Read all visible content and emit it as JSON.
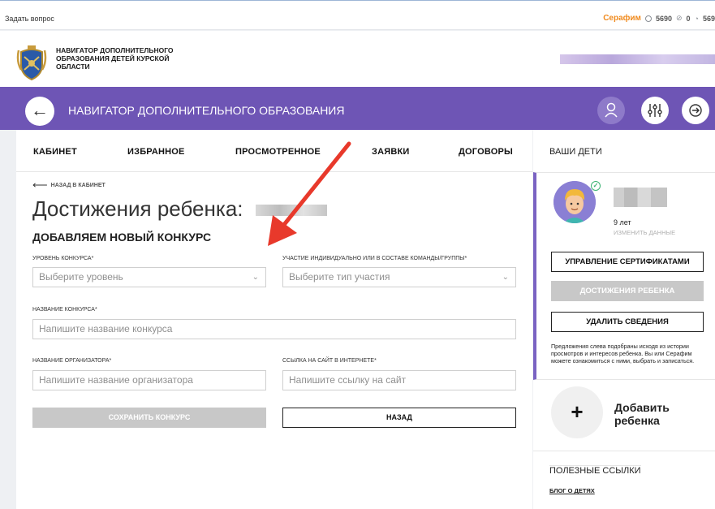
{
  "topbar": {
    "ask_label": "Задать вопрос",
    "user_name": "Серафим",
    "stats": [
      "5690",
      "0",
      "569"
    ]
  },
  "header": {
    "logo_text": "НАВИГАТОР ДОПОЛНИТЕЛЬНОГО ОБРАЗОВАНИЯ ДЕТЕЙ КУРСКОЙ ОБЛАСТИ"
  },
  "navbar": {
    "title": "НАВИГАТОР ДОПОЛНИТЕЛЬНОГО ОБРАЗОВАНИЯ",
    "accent": "#6e55b5"
  },
  "tabs": [
    "КАБИНЕТ",
    "ИЗБРАННОЕ",
    "ПРОСМОТРЕННОЕ",
    "ЗАЯВКИ",
    "ДОГОВОРЫ"
  ],
  "main": {
    "back_link": "НАЗАД В КАБИНЕТ",
    "page_title": "Достижения ребенка:",
    "section_title": "ДОБАВЛЯЕМ НОВЫЙ КОНКУРС",
    "form": {
      "level_label": "УРОВЕНЬ КОНКУРСА*",
      "level_value": "Выберите уровень",
      "participation_label": "УЧАСТИЕ ИНДИВИДУАЛЬНО ИЛИ В СОСТАВЕ КОМАНДЫ/ГРУППЫ*",
      "participation_value": "Выберите тип участия",
      "name_label": "НАЗВАНИЕ КОНКУРСА*",
      "name_placeholder": "Напишите название конкурса",
      "organizer_label": "НАЗВАНИЕ ОРГАНИЗАТОРА*",
      "organizer_placeholder": "Напишите название организатора",
      "link_label": "ССЫЛКА НА САЙТ В ИНТЕРНЕТЕ*",
      "link_placeholder": "Напишите ссылку на сайт",
      "save_label": "СОХРАНИТЬ КОНКУРС",
      "back_label": "НАЗАД"
    }
  },
  "sidebar": {
    "heading": "ВАШИ ДЕТИ",
    "child": {
      "age": "9 лет",
      "edit_label": "ИЗМЕНИТЬ ДАННЫЕ"
    },
    "buttons": {
      "certificates": "УПРАВЛЕНИЕ СЕРТИФИКАТАМИ",
      "achievements": "ДОСТИЖЕНИЯ РЕБЕНКА",
      "delete": "УДАЛИТЬ СВЕДЕНИЯ"
    },
    "hint": "Предложения слева подобраны исходя из истории просмотров и интересов ребенка. Вы или Серафим можете ознакомиться с ними, выбрать и записаться.",
    "add_child": "Добавить ребенка",
    "links_heading": "ПОЛЕЗНЫЕ ССЫЛКИ",
    "blog_link": "БЛОГ О ДЕТЯХ"
  }
}
